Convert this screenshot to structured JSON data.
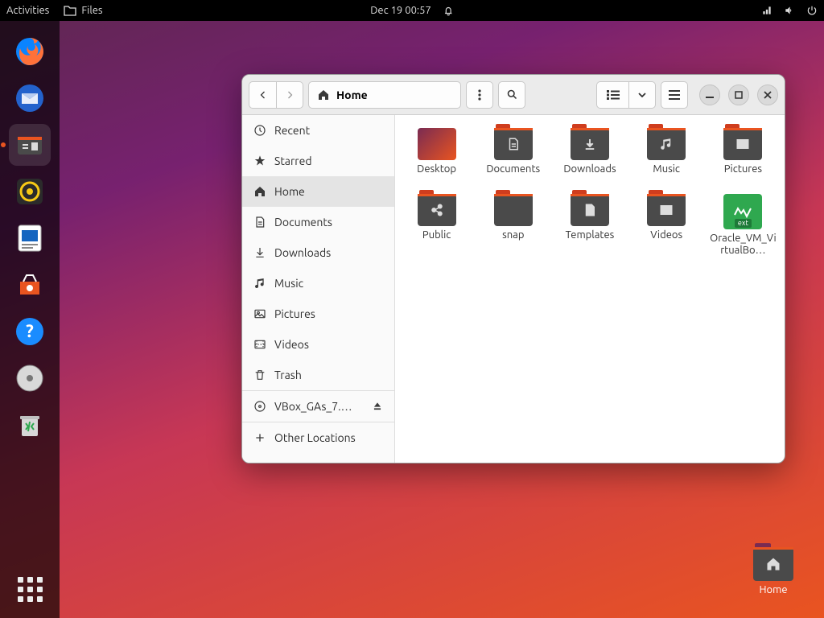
{
  "topbar": {
    "activities": "Activities",
    "files": "Files",
    "datetime": "Dec 19  00:57"
  },
  "dock": {
    "items": [
      "firefox",
      "thunderbird",
      "files",
      "rhythmbox",
      "libreoffice-writer",
      "software",
      "help",
      "disc",
      "trash"
    ],
    "active": "files"
  },
  "desktop": {
    "home_label": "Home"
  },
  "window": {
    "path_label": "Home",
    "sidebar": [
      {
        "icon": "recent",
        "label": "Recent"
      },
      {
        "icon": "star",
        "label": "Starred"
      },
      {
        "icon": "home",
        "label": "Home",
        "selected": true
      },
      {
        "icon": "documents",
        "label": "Documents"
      },
      {
        "icon": "downloads",
        "label": "Downloads"
      },
      {
        "icon": "music",
        "label": "Music"
      },
      {
        "icon": "pictures",
        "label": "Pictures"
      },
      {
        "icon": "videos",
        "label": "Videos"
      },
      {
        "icon": "trash",
        "label": "Trash"
      }
    ],
    "mount": {
      "label": "VBox_GAs_7.…"
    },
    "other_locations": "Other Locations",
    "items": [
      {
        "type": "desktop-thumb",
        "label": "Desktop"
      },
      {
        "type": "folder",
        "glyph": "documents",
        "label": "Documents"
      },
      {
        "type": "folder",
        "glyph": "downloads",
        "label": "Downloads"
      },
      {
        "type": "folder",
        "glyph": "music",
        "label": "Music"
      },
      {
        "type": "folder",
        "glyph": "pictures",
        "label": "Pictures"
      },
      {
        "type": "folder",
        "glyph": "public",
        "label": "Public"
      },
      {
        "type": "folder",
        "glyph": "plain",
        "label": "snap"
      },
      {
        "type": "folder",
        "glyph": "templates",
        "label": "Templates"
      },
      {
        "type": "folder",
        "glyph": "videos",
        "label": "Videos"
      },
      {
        "type": "ext",
        "label": "Oracle_VM_VirtualBo…"
      }
    ]
  }
}
